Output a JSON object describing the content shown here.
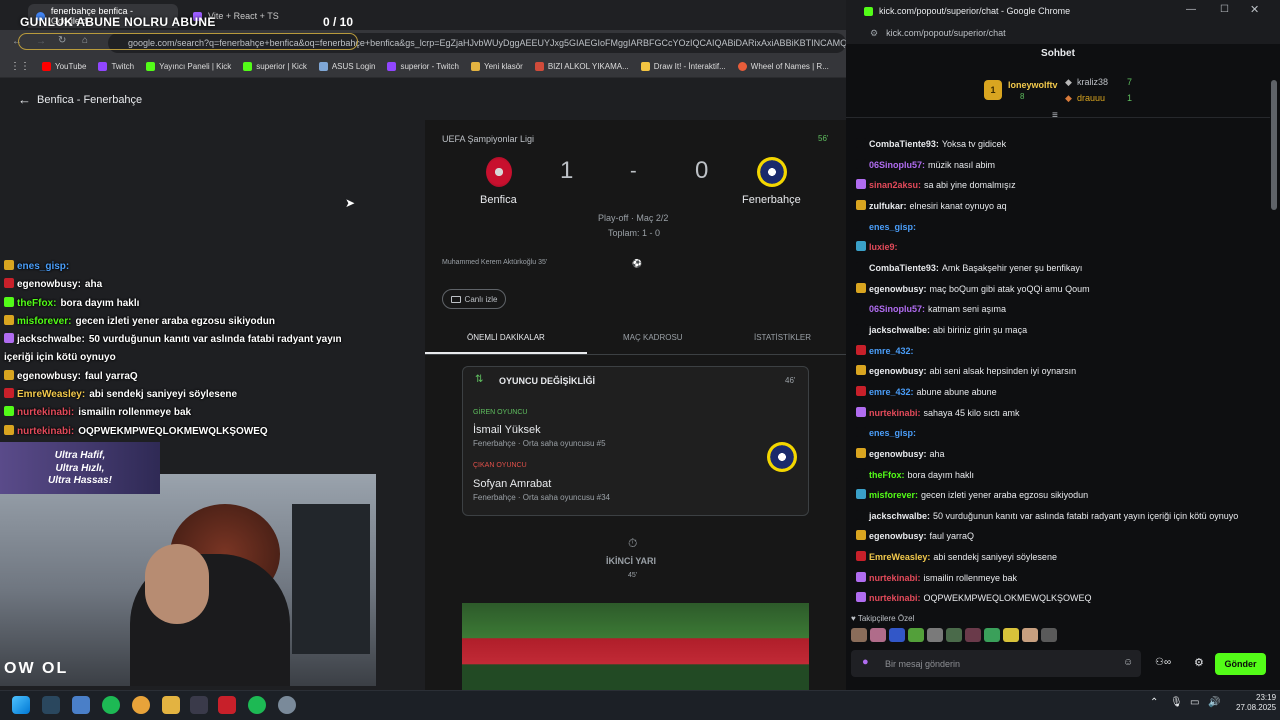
{
  "left_browser": {
    "tabs": [
      "fenerbahçe benfica - Google'd",
      "Vite + React + TS"
    ],
    "overlay_title": "GUNLUK ABUNE NOLRU ABUNE",
    "overlay_count": "0 / 10",
    "url": "google.com/search?q=fenerbahçe+benfica&oq=fenerbahçe+benfica&gs_lcrp=EgZjaHJvbWUyDggAEEUYJxg5GIAEGIoFMggIARBFGCcYOzIQCAIQABiDARixAxiABBiKBTINCAMQ",
    "bookmarks": [
      "YouTube",
      "Twitch",
      "Yayıncı Paneli | Kick",
      "superior | Kick",
      "ASUS Login",
      "superior - Twitch",
      "Yeni klasör",
      "BIZI ALKOL YIKAMA...",
      "Draw It! - İnteraktif...",
      "Wheel of Names | R..."
    ],
    "back_title": "Benfica - Fenerbahçe"
  },
  "overlay_chat": [
    {
      "user": "enes_gisp:",
      "text": "",
      "color": "#4a9df8"
    },
    {
      "user": "egenowbusy:",
      "text": "aha",
      "color": "#ffffff"
    },
    {
      "user": "theFfox:",
      "text": "bora dayım haklı",
      "color": "#53fc18"
    },
    {
      "user": "misforever:",
      "text": "gecen izleti yener araba egzosu sikiyodun",
      "color": "#53fc18"
    },
    {
      "user": "jackschwalbe:",
      "text": "50 vurduğunun kanıtı var aslında fatabi radyant yayın içeriği için kötü oynuyo",
      "color": "#ffffff"
    },
    {
      "user": "egenowbusy:",
      "text": "faul yarraQ",
      "color": "#ffffff"
    },
    {
      "user": "EmreWeasley:",
      "text": "abi sendekj saniyeyi söylesene",
      "color": "#f2c94c"
    },
    {
      "user": "nurtekinabi:",
      "text": "ismailin rollenmeye bak",
      "color": "#e24a5a"
    },
    {
      "user": "nurtekinabi:",
      "text": "OQPWEKMPWEQLOKMEWQLKŞOWEQ",
      "color": "#e24a5a"
    }
  ],
  "ultra_banner": [
    "Ultra Hafif,",
    "Ultra Hızlı,",
    "Ultra Hassas!"
  ],
  "cam_logo": "OW OL",
  "match": {
    "competition": "UEFA Şampiyonlar Ligi",
    "minute": "56'",
    "home": "Benfica",
    "away": "Fenerbahçe",
    "home_score": "1",
    "dash": "-",
    "away_score": "0",
    "stage": "Play-off · Maç 2/2",
    "aggregate": "Toplam: 1 - 0",
    "scorer": "Muhammed Kerem Aktürkoğlu 35'",
    "watch_label": "Canlı izle",
    "tabs": [
      "ÖNEMLİ DAKİKALAR",
      "MAÇ KADROSU",
      "İSTATİSTİKLER"
    ],
    "sub": {
      "title": "OYUNCU DEĞİŞİKLİĞİ",
      "minute": "46'",
      "in_label": "GİREN OYUNCU",
      "in_name": "İsmail Yüksek",
      "in_info": "Fenerbahçe · Orta saha oyuncusu #5",
      "out_label": "ÇIKAN OYUNCU",
      "out_name": "Sofyan Amrabat",
      "out_info": "Fenerbahçe · Orta saha oyuncusu #34"
    },
    "half_label": "İKİNCİ YARI",
    "half_minute": "45'"
  },
  "right_browser": {
    "title": "kick.com/popout/superior/chat - Google Chrome",
    "url": "kick.com/popout/superior/chat",
    "header": "Sohbet",
    "leaders": [
      {
        "name": "loneywolftv",
        "count": "8"
      },
      {
        "name": "kraliz38",
        "count": "7"
      },
      {
        "name": "drauuu",
        "count": "1"
      }
    ]
  },
  "chat": [
    {
      "user": "CombaTiente93:",
      "text": "Yoksa tv gidicek",
      "color": "#e8eaed"
    },
    {
      "user": "06Sinoplu57:",
      "text": "müzik nasıl abim",
      "color": "#b06cf0"
    },
    {
      "user": "sinan2aksu:",
      "text": "sa abi yine domalmışız",
      "color": "#e24a5a"
    },
    {
      "user": "zulfukar:",
      "text": "elnesiri kanat oynuyo aq",
      "color": "#e8eaed"
    },
    {
      "user": "enes_gisp:",
      "text": "",
      "color": "#4a9df8"
    },
    {
      "user": "luxie9:",
      "text": "",
      "color": "#e24a5a"
    },
    {
      "user": "CombaTiente93:",
      "text": "Amk Başakşehir yener şu benfikayı",
      "color": "#e8eaed"
    },
    {
      "user": "egenowbusy:",
      "text": "maç boQum gibi atak yoQQi amu Qoum",
      "color": "#e8eaed"
    },
    {
      "user": "06Sinoplu57:",
      "text": "katmam seni aşıma",
      "color": "#b06cf0"
    },
    {
      "user": "jackschwalbe:",
      "text": "abi biriniz girin şu maça",
      "color": "#e8eaed"
    },
    {
      "user": "emre_432:",
      "text": "",
      "color": "#4a9df8"
    },
    {
      "user": "egenowbusy:",
      "text": "abi seni alsak hepsinden iyi oynarsın",
      "color": "#e8eaed"
    },
    {
      "user": "emre_432:",
      "text": "abune abune abune",
      "color": "#4a9df8"
    },
    {
      "user": "nurtekinabi:",
      "text": "sahaya 45 kilo sıctı amk",
      "color": "#e24a5a"
    },
    {
      "user": "enes_gisp:",
      "text": "",
      "color": "#4a9df8"
    },
    {
      "user": "egenowbusy:",
      "text": "aha",
      "color": "#e8eaed"
    },
    {
      "user": "theFfox:",
      "text": "bora dayım haklı",
      "color": "#53fc18"
    },
    {
      "user": "misforever:",
      "text": "gecen izleti yener araba egzosu sikiyodun",
      "color": "#53fc18"
    },
    {
      "user": "jackschwalbe:",
      "text": "50 vurduğunun kanıtı var aslında fatabi radyant yayın içeriği için kötü oynuyo",
      "color": "#e8eaed"
    },
    {
      "user": "egenowbusy:",
      "text": "faul yarraQ",
      "color": "#e8eaed"
    },
    {
      "user": "EmreWeasley:",
      "text": "abi sendekj saniyeyi söylesene",
      "color": "#f2c94c"
    },
    {
      "user": "nurtekinabi:",
      "text": "ismailin rollenmeye bak",
      "color": "#e24a5a"
    },
    {
      "user": "nurtekinabi:",
      "text": "OQPWEKMPWEQLOKMEWQLKŞOWEQ",
      "color": "#e24a5a"
    }
  ],
  "followers_label": "Takipçilere Özel",
  "message_placeholder": "Bir mesaj gönderin",
  "send_label": "Gönder",
  "taskbar": {
    "time": "23:19",
    "date": "27.08.2025"
  },
  "colors": {
    "kick_green": "#53fc18",
    "page_bg": "#1e1f22",
    "chat_bg": "#0e0f11"
  }
}
